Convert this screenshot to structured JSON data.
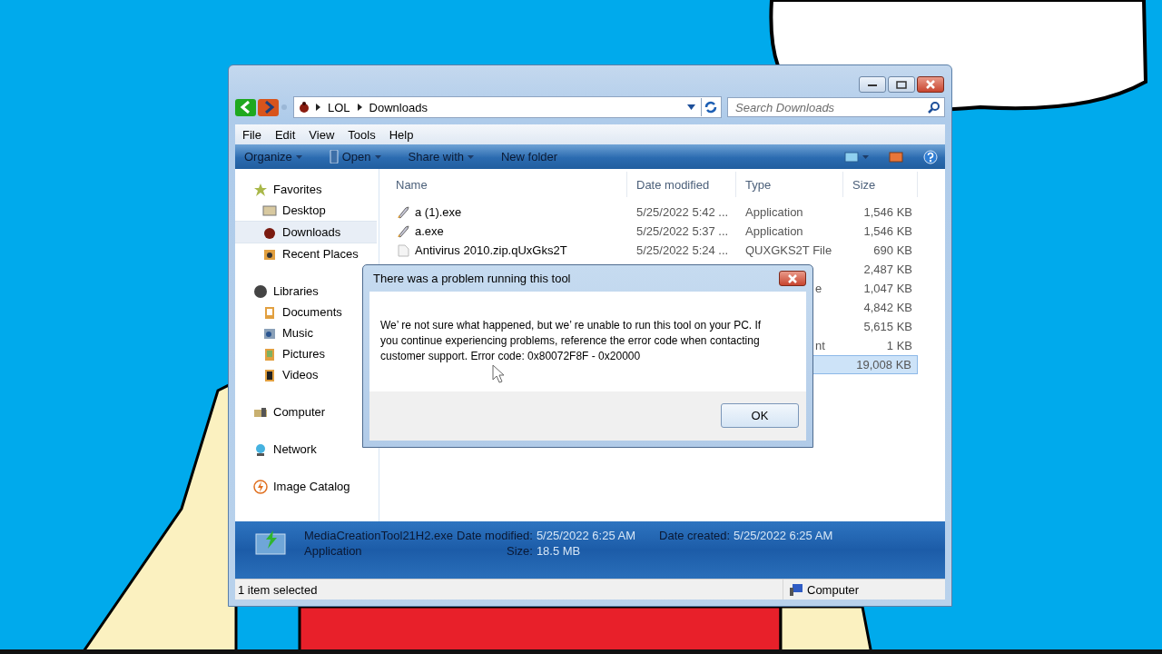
{
  "explorer": {
    "breadcrumbs": [
      "LOL",
      "Downloads"
    ],
    "search": {
      "placeholder": "Search Downloads"
    },
    "menu": [
      "File",
      "Edit",
      "View",
      "Tools",
      "Help"
    ],
    "toolbar": [
      {
        "label": "Organize",
        "dropdown": true
      },
      {
        "label": "Open",
        "dropdown": true
      },
      {
        "label": "Share with",
        "dropdown": true
      },
      {
        "label": "New folder",
        "dropdown": false
      }
    ],
    "sidebar": {
      "items": [
        {
          "label": "Favorites",
          "selected": false,
          "children": [
            {
              "label": "Desktop",
              "selected": false
            },
            {
              "label": "Downloads",
              "selected": true
            },
            {
              "label": "Recent Places",
              "selected": false
            }
          ]
        },
        {
          "label": "Libraries",
          "selected": false,
          "children": [
            {
              "label": "Documents",
              "selected": false
            },
            {
              "label": "Music",
              "selected": false
            },
            {
              "label": "Pictures",
              "selected": false
            },
            {
              "label": "Videos",
              "selected": false
            }
          ]
        },
        {
          "label": "Computer",
          "selected": false
        },
        {
          "label": "Network",
          "selected": false
        },
        {
          "label": "Image Catalog",
          "selected": false
        }
      ]
    },
    "table": {
      "columns": [
        "Name",
        "Date modified",
        "Type",
        "Size"
      ],
      "rows": [
        {
          "kind": "full",
          "selected": false,
          "name": "a (1).exe",
          "date": "5/25/2022 5:42 ...",
          "type": "Application",
          "size": "1,546 KB"
        },
        {
          "kind": "full",
          "selected": false,
          "name": "a.exe",
          "date": "5/25/2022 5:37 ...",
          "type": "Application",
          "size": "1,546 KB"
        },
        {
          "kind": "full",
          "selected": false,
          "name": "Antivirus 2010.zip.qUxGks2T",
          "date": "5/25/2022 5:24 ...",
          "type": "QUXGKS2T File",
          "size": "690 KB"
        },
        {
          "kind": "covered",
          "selected": false,
          "size": "2,487 KB"
        },
        {
          "kind": "covered",
          "selected": false,
          "type": "e",
          "size": "1,047 KB"
        },
        {
          "kind": "covered",
          "selected": false,
          "size": "4,842 KB"
        },
        {
          "kind": "covered",
          "selected": false,
          "size": "5,615 KB"
        },
        {
          "kind": "covered",
          "selected": false,
          "type": "nt",
          "size": "1 KB"
        },
        {
          "kind": "covered",
          "selected": true,
          "size": "19,008 KB"
        }
      ]
    },
    "details": {
      "name": "MediaCreationTool21H2.exe",
      "type": "Application",
      "fields": [
        {
          "label": "Date modified:",
          "value": "5/25/2022 6:25 AM"
        },
        {
          "label": "Date created:",
          "value": "5/25/2022 6:25 AM"
        },
        {
          "label": "Size:",
          "value": "18.5 MB"
        }
      ]
    },
    "status_bar": {
      "text": "1 item selected",
      "location": "Computer"
    }
  },
  "dialog": {
    "title": "There was a problem running this tool",
    "message": "We’ re not sure what happened, but we’ re unable to run this tool on your PC. If you continue experiencing problems, reference the error code when contacting customer support. Error code: 0x80072F8F - 0x20000",
    "button": "OK"
  }
}
